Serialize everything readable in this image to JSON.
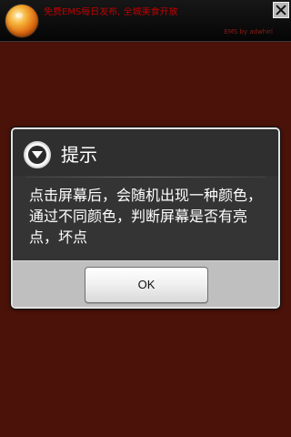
{
  "ad": {
    "main_text": "免费EMS每日发布, 全城美食开放",
    "sub_text": "EMS by adwhirl",
    "close_icon": "close-icon"
  },
  "dialog": {
    "title": "提示",
    "icon": "down-arrow-circle-icon",
    "message": "点击屏幕后，会随机出现一种颜色，通过不同颜色，判断屏幕是否有亮点，坏点",
    "ok_label": "OK"
  },
  "colors": {
    "background": "#4a1208",
    "banner": "#111111",
    "dialog": "#343434",
    "button_bar": "#bfbfbf",
    "ad_text": "#c00000"
  }
}
